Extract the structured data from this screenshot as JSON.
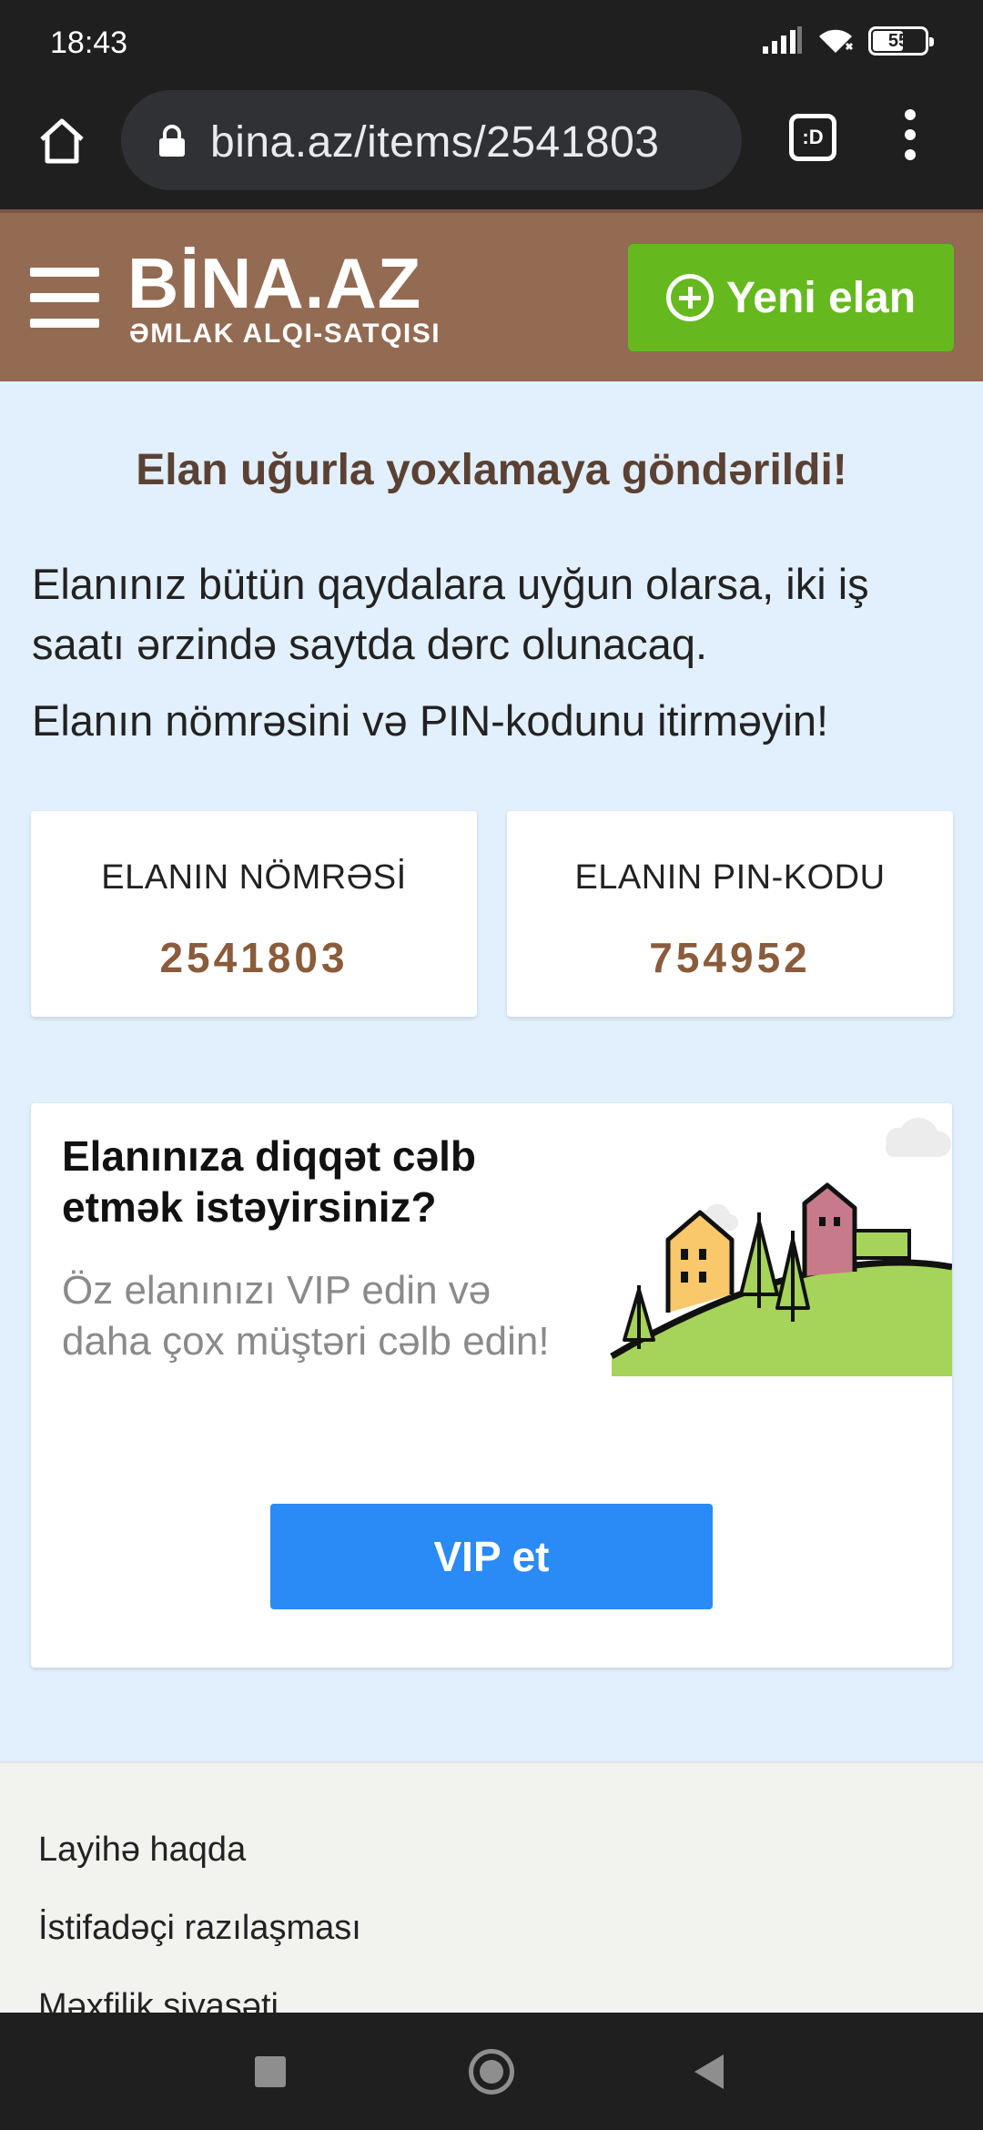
{
  "status_bar": {
    "time": "18:43",
    "battery": "55",
    "icons": [
      "signal-icon",
      "wifi-icon",
      "battery-icon"
    ]
  },
  "browser": {
    "url": "bina.az/items/2541803",
    "tab_label": ":D",
    "icons": [
      "home-icon",
      "lock-icon",
      "tab-switcher-icon",
      "more-vert-icon"
    ]
  },
  "header": {
    "logo_main": "BİNA.AZ",
    "logo_sub": "ƏMLAK ALQI-SATQISI",
    "new_ad_label": "Yeni elan",
    "colors": {
      "header_bg": "#936a52",
      "new_ad_bg": "#65b91e"
    }
  },
  "main": {
    "success_title": "Elan uğurla yoxlamaya göndərildi!",
    "info_text": "Elanınız bütün qaydalara uyğun olarsa, iki iş saatı ərzində saytda dərc olunacaq.",
    "warn_text": "Elanın nömrəsini və PIN-kodunu itirməyin!",
    "ad_number_label": "ELANIN NÖMRƏSİ",
    "ad_number_value": "2541803",
    "pin_label": "ELANIN PIN-KODU",
    "pin_value": "754952",
    "vip": {
      "title": "Elanınıza diqqət cəlb etmək istəyirsiniz?",
      "description": "Öz elanınızı VIP edin və daha çox müştəri cəlb edin!",
      "button_label": "VIP et",
      "button_color": "#2a8af6"
    }
  },
  "footer": {
    "links": [
      "Layihə haqda",
      "İstifadəçi razılaşması",
      "Məxfilik siyasəti"
    ]
  },
  "nav_bar": {
    "icons": [
      "recent-apps-icon",
      "home-nav-icon",
      "back-icon"
    ]
  }
}
